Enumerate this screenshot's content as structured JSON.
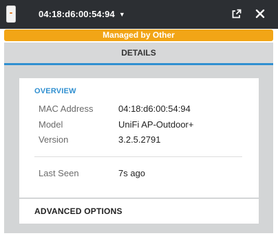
{
  "header": {
    "device_name": "04:18:d6:00:54:94",
    "caret": "▼",
    "device_icon": "access-point-icon",
    "popout_icon": "popout-icon",
    "close_icon": "close-icon"
  },
  "banner": {
    "text": "Managed by Other",
    "color": "#f2a516"
  },
  "tabs": [
    {
      "label": "DETAILS",
      "active": true
    }
  ],
  "overview": {
    "title": "OVERVIEW",
    "rows": [
      {
        "label": "MAC Address",
        "value": "04:18:d6:00:54:94"
      },
      {
        "label": "Model",
        "value": "UniFi AP-Outdoor+"
      },
      {
        "label": "Version",
        "value": "3.2.5.2791"
      }
    ],
    "last_seen": {
      "label": "Last Seen",
      "value": "7s ago"
    }
  },
  "advanced": {
    "label": "ADVANCED OPTIONS"
  },
  "colors": {
    "titlebar": "#2c2f33",
    "accent": "#2f8fd0",
    "banner": "#f2a516",
    "tabbar": "#d7d8d9",
    "content_bg": "#d3d5d6"
  }
}
